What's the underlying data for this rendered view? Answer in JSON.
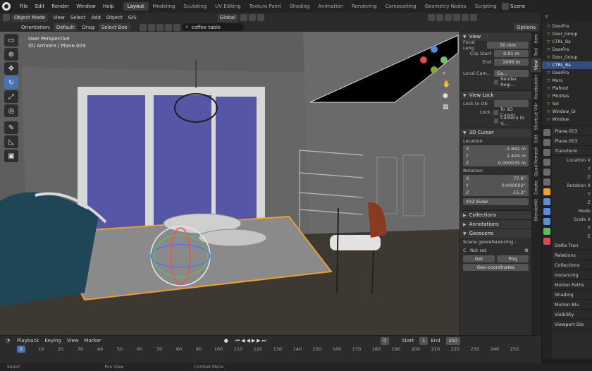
{
  "menubar": {
    "items": [
      "File",
      "Edit",
      "Render",
      "Window",
      "Help"
    ],
    "workspaces": [
      "Layout",
      "Modeling",
      "Sculpting",
      "UV Editing",
      "Texture Paint",
      "Shading",
      "Animation",
      "Rendering",
      "Compositing",
      "Geometry Nodes",
      "Scripting"
    ],
    "active_workspace": "Layout",
    "scene": "Scene"
  },
  "viewport_header": {
    "mode": "Object Mode",
    "menus": [
      "View",
      "Select",
      "Add",
      "Object",
      "GIS"
    ],
    "transform_orientation": "Global",
    "orientation_label": "Orientation:",
    "orientation_value": "Default",
    "drag_label": "Drag:",
    "drag_value": "Select Box",
    "search_value": "coffee table",
    "options": "Options"
  },
  "viewport": {
    "view_name": "User Perspective",
    "object_info": "(0) Armoire | Plane.003"
  },
  "toolbar_icons": [
    "select-box-icon",
    "cursor-icon",
    "move-icon",
    "rotate-icon",
    "scale-icon",
    "transform-icon",
    "annotate-icon",
    "measure-icon",
    "add-cube-icon"
  ],
  "npanel": {
    "view_header": "View",
    "focal_length_label": "Focal Leng",
    "focal_length": "50 mm",
    "clip_start_label": "Clip Start",
    "clip_start": "0.01 m",
    "clip_end_label": "End",
    "clip_end": "1000 m",
    "local_camera_label": "Local Cam...",
    "local_camera_value": "Ca...",
    "render_region": "Render Regi...",
    "view_lock_header": "View Lock",
    "lock_to_object_label": "Lock to Ob",
    "lock_label": "Lock",
    "to_3d_cursor": "To 3D Cursor",
    "camera_to_view": "Camera to V...",
    "cursor_header": "3D Cursor",
    "location_label": "Location:",
    "loc_x_label": "X",
    "loc_x": "-1.642 m",
    "loc_y_label": "Y",
    "loc_y": "1.424 m",
    "loc_z_label": "Z",
    "loc_z": "0.000035 m",
    "rotation_label": "Rotation:",
    "rot_x_label": "X",
    "rot_x": "77.6°",
    "rot_y_label": "Y",
    "rot_y": "0.000002°",
    "rot_z_label": "Z",
    "rot_z": "-15.2°",
    "rotation_mode": "XYZ Euler",
    "collections_header": "Collections",
    "annotations_header": "Annotations",
    "geoscene_header": "Geoscene",
    "georef_label": "Scene georeferencing :",
    "crs_label": "C",
    "crs_value": "Not set",
    "get_btn": "Get",
    "proj_btn": "Proj",
    "geocoords_btn": "Geo-coordinates"
  },
  "vertical_tabs": [
    "Item",
    "Tool",
    "View",
    "Facebuilder",
    "Shortcut VUr",
    "Edit",
    "Quad Remesh",
    "Create",
    "BlenderKit"
  ],
  "active_vertical_tab": "View",
  "outliner": {
    "rows": [
      "DoorFra",
      "Door_Group",
      "CTRL_Ba",
      "DoorFra",
      "Door_Group",
      "CTRL_Ba",
      "DoorFra",
      "Murs",
      "Plafond",
      "Plinthes",
      "Sol",
      "Window_Gr",
      "Window"
    ],
    "selected_index": 5
  },
  "properties": {
    "object_name": "Plane.003",
    "data_name": "Plane.003",
    "transform_header": "Transform",
    "location_label": "Location X",
    "y_label": "Y",
    "z_label": "Z",
    "rotation_label": "Rotation X",
    "mode_label": "Mode",
    "scale_label": "Scale X",
    "delta_header": "Delta Tran",
    "sections": [
      "Relations",
      "Collections",
      "Instancing",
      "Motion Paths",
      "Shading",
      "Motion Blu",
      "Visibility",
      "Viewport Dis"
    ]
  },
  "timeline": {
    "menus": [
      "Playback",
      "Keying",
      "View",
      "Marker"
    ],
    "current_frame": "0",
    "start_label": "Start",
    "start": "1",
    "end_label": "End",
    "end": "250",
    "ticks": [
      "10",
      "20",
      "30",
      "40",
      "50",
      "60",
      "70",
      "80",
      "90",
      "100",
      "110",
      "120",
      "130",
      "140",
      "150",
      "160",
      "170",
      "180",
      "190",
      "200",
      "210",
      "220",
      "230",
      "240",
      "250"
    ],
    "ruler_start": "0"
  },
  "statusbar": {
    "items": [
      "Select",
      "Pan View",
      "Context Menu"
    ]
  },
  "colors": {
    "accent": "#4772b3",
    "sofa": "#1e4656",
    "window_glass": "#5656a6",
    "rug_outline": "#e8a030"
  }
}
